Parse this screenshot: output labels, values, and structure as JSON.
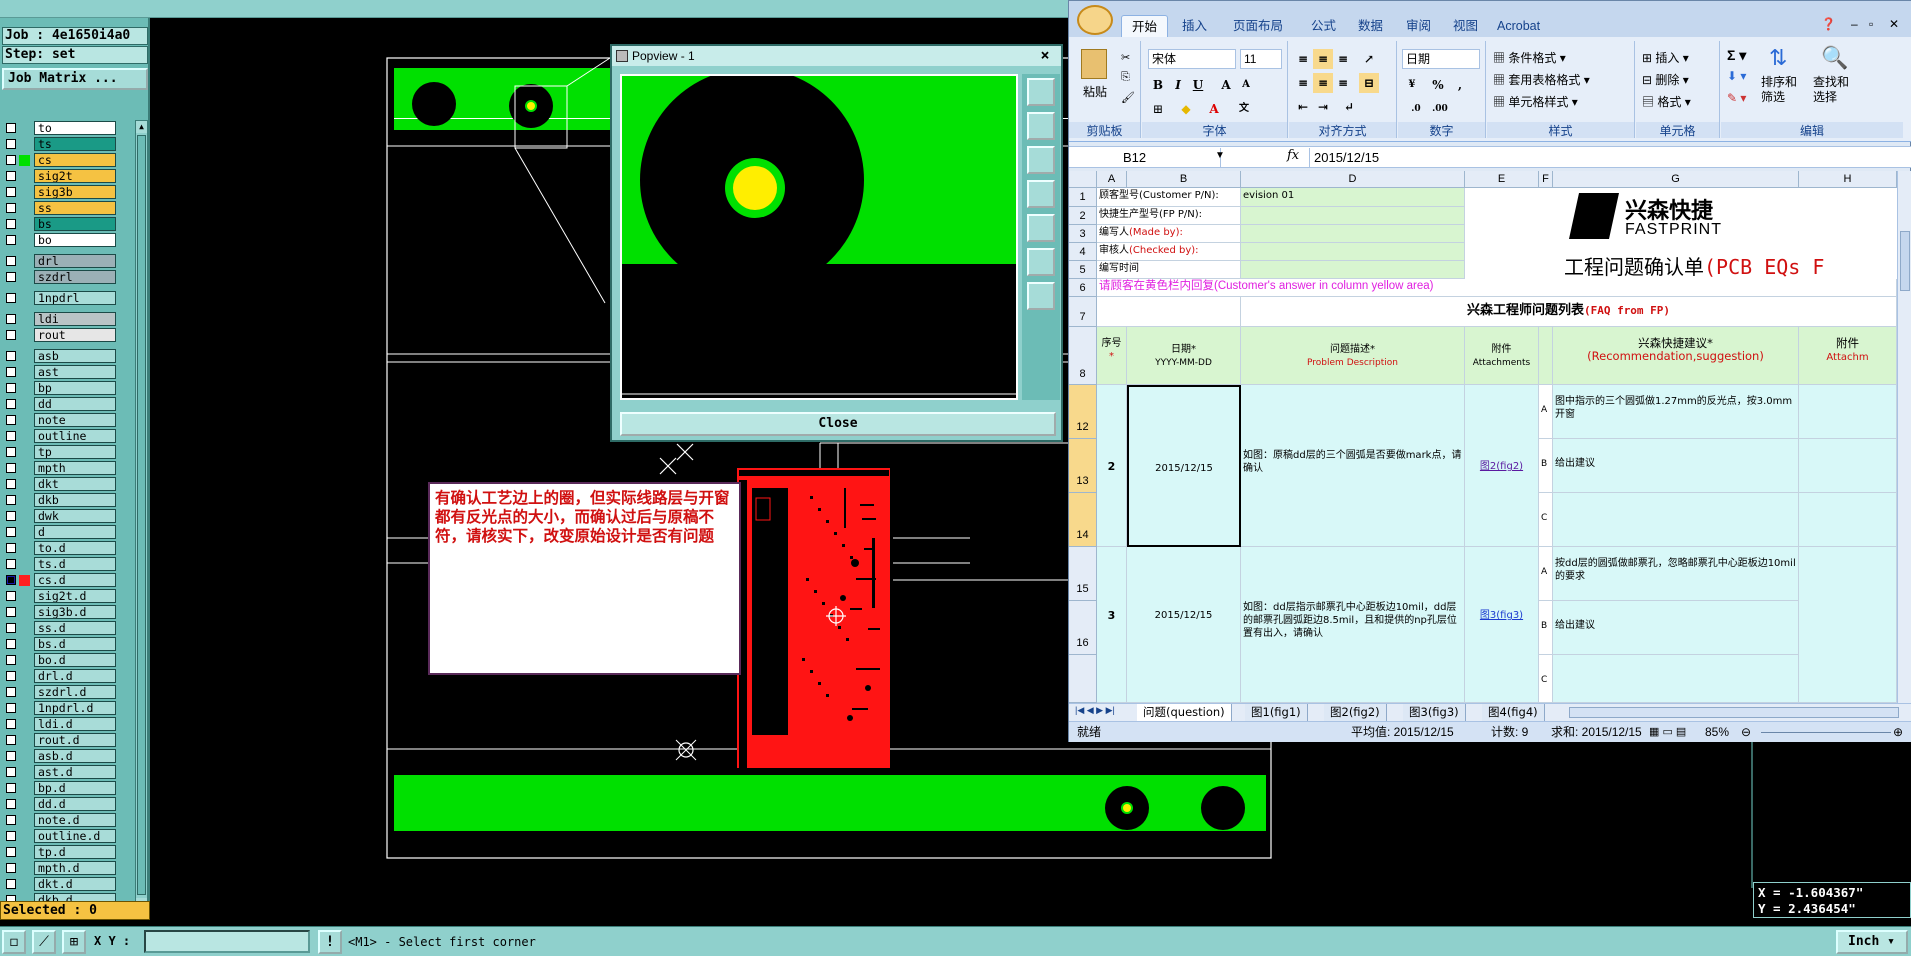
{
  "job_info": {
    "job": "Job : 4e1650i4a0",
    "step": "Step: set",
    "job_matrix_button": "Job Matrix ..."
  },
  "layers": [
    {
      "name": "to",
      "bg": "#ffffff",
      "sw": "",
      "checked": false
    },
    {
      "name": "ts",
      "bg": "#1a9a86",
      "sw": "",
      "checked": false
    },
    {
      "name": "cs",
      "bg": "#f5c242",
      "sw": "#00e000",
      "checked": false
    },
    {
      "name": "sig2t",
      "bg": "#f5c242",
      "sw": "",
      "checked": false
    },
    {
      "name": "sig3b",
      "bg": "#f5c242",
      "sw": "",
      "checked": false
    },
    {
      "name": "ss",
      "bg": "#f5c242",
      "sw": "",
      "checked": false
    },
    {
      "name": "bs",
      "bg": "#1a9a86",
      "sw": "",
      "checked": false
    },
    {
      "name": "bo",
      "bg": "#ffffff",
      "sw": "",
      "checked": false
    },
    {
      "name": "drl",
      "bg": "#9bb0b6",
      "sw": "",
      "checked": false,
      "sep": true
    },
    {
      "name": "szdrl",
      "bg": "#9bb0b6",
      "sw": "",
      "checked": false
    },
    {
      "name": "1npdrl",
      "bg": "#a8dcd8",
      "sw": "",
      "checked": false,
      "sep": true
    },
    {
      "name": "ldi",
      "bg": "#b9c4c6",
      "sw": "",
      "checked": false,
      "sep": true
    },
    {
      "name": "rout",
      "bg": "#e6e6e6",
      "sw": "",
      "checked": false
    },
    {
      "name": "asb",
      "bg": "#a8dcd8",
      "sw": "",
      "checked": false,
      "sep": true
    },
    {
      "name": "ast",
      "bg": "#a8dcd8",
      "sw": "",
      "checked": false
    },
    {
      "name": "bp",
      "bg": "#a8dcd8",
      "sw": "",
      "checked": false
    },
    {
      "name": "dd",
      "bg": "#a8dcd8",
      "sw": "",
      "checked": false
    },
    {
      "name": "note",
      "bg": "#a8dcd8",
      "sw": "",
      "checked": false
    },
    {
      "name": "outline",
      "bg": "#a8dcd8",
      "sw": "",
      "checked": false
    },
    {
      "name": "tp",
      "bg": "#a8dcd8",
      "sw": "",
      "checked": false
    },
    {
      "name": "mpth",
      "bg": "#a8dcd8",
      "sw": "",
      "checked": false
    },
    {
      "name": "dkt",
      "bg": "#a8dcd8",
      "sw": "",
      "checked": false
    },
    {
      "name": "dkb",
      "bg": "#a8dcd8",
      "sw": "",
      "checked": false
    },
    {
      "name": "dwk",
      "bg": "#a8dcd8",
      "sw": "",
      "checked": false
    },
    {
      "name": "d",
      "bg": "#a8dcd8",
      "sw": "",
      "checked": false
    },
    {
      "name": "to.d",
      "bg": "#a8dcd8",
      "sw": "",
      "checked": false
    },
    {
      "name": "ts.d",
      "bg": "#a8dcd8",
      "sw": "",
      "checked": false
    },
    {
      "name": "cs.d",
      "bg": "#a8dcd8",
      "sw": "#ff2020",
      "checked": true
    },
    {
      "name": "sig2t.d",
      "bg": "#a8dcd8",
      "sw": "",
      "checked": false
    },
    {
      "name": "sig3b.d",
      "bg": "#a8dcd8",
      "sw": "",
      "checked": false
    },
    {
      "name": "ss.d",
      "bg": "#a8dcd8",
      "sw": "",
      "checked": false
    },
    {
      "name": "bs.d",
      "bg": "#a8dcd8",
      "sw": "",
      "checked": false
    },
    {
      "name": "bo.d",
      "bg": "#a8dcd8",
      "sw": "",
      "checked": false
    },
    {
      "name": "drl.d",
      "bg": "#a8dcd8",
      "sw": "",
      "checked": false
    },
    {
      "name": "szdrl.d",
      "bg": "#a8dcd8",
      "sw": "",
      "checked": false
    },
    {
      "name": "1npdrl.d",
      "bg": "#a8dcd8",
      "sw": "",
      "checked": false
    },
    {
      "name": "ldi.d",
      "bg": "#a8dcd8",
      "sw": "",
      "checked": false
    },
    {
      "name": "rout.d",
      "bg": "#a8dcd8",
      "sw": "",
      "checked": false
    },
    {
      "name": "asb.d",
      "bg": "#a8dcd8",
      "sw": "",
      "checked": false
    },
    {
      "name": "ast.d",
      "bg": "#a8dcd8",
      "sw": "",
      "checked": false
    },
    {
      "name": "bp.d",
      "bg": "#a8dcd8",
      "sw": "",
      "checked": false
    },
    {
      "name": "dd.d",
      "bg": "#a8dcd8",
      "sw": "",
      "checked": false
    },
    {
      "name": "note.d",
      "bg": "#a8dcd8",
      "sw": "",
      "checked": false
    },
    {
      "name": "outline.d",
      "bg": "#a8dcd8",
      "sw": "",
      "checked": false
    },
    {
      "name": "tp.d",
      "bg": "#a8dcd8",
      "sw": "",
      "checked": false
    },
    {
      "name": "mpth.d",
      "bg": "#a8dcd8",
      "sw": "",
      "checked": false
    },
    {
      "name": "dkt.d",
      "bg": "#a8dcd8",
      "sw": "",
      "checked": false
    },
    {
      "name": "dkb.d",
      "bg": "#a8dcd8",
      "sw": "",
      "checked": false
    }
  ],
  "selected": "Selected : 0",
  "status": {
    "xy_label": "X Y :",
    "xy_value": "",
    "message": "<M1> - Select first corner",
    "unit": "Inch",
    "x_readout": "X = -1.604367\"",
    "y_readout": "Y = 2.436454\""
  },
  "popview": {
    "title": "Popview - 1",
    "close_x": "×",
    "close_button": "Close"
  },
  "note_text": "有确认工艺边上的圈，但实际线路层与开窗都有反光点的大小，而确认过后与原稿不符，请核实下，改变原始设计是否有问题",
  "excel": {
    "tabs": [
      "开始",
      "插入",
      "页面布局",
      "公式",
      "数据",
      "审阅",
      "视图",
      "Acrobat"
    ],
    "ribbon": {
      "paste": "粘贴",
      "font_name": "宋体",
      "font_size": "11",
      "number_format": "日期",
      "cond_format": "条件格式",
      "table_format": "套用表格格式",
      "cell_style": "单元格样式",
      "insert": "插入",
      "delete": "删除",
      "format": "格式",
      "sort_filter": "排序和\n筛选",
      "find_select": "查找和\n选择",
      "groups": [
        "剪贴板",
        "字体",
        "对齐方式",
        "数字",
        "样式",
        "单元格",
        "编辑"
      ]
    },
    "name_box": "B12",
    "fx": "fx",
    "formula": "2015/12/15",
    "col_headers": [
      "A",
      "B",
      "D",
      "E",
      "F",
      "G",
      "H"
    ],
    "row_labels": [
      "1",
      "2",
      "3",
      "4",
      "5",
      "6",
      "7",
      "8",
      "12",
      "13",
      "14",
      "15",
      "16"
    ],
    "rows": {
      "r1": "顾客型号(Customer P/N):",
      "r1_val": "evision 01",
      "r2": "快捷生产型号(FP P/N):",
      "r3a": "编写人",
      "r3b": "(Made by):",
      "r4a": "审核人",
      "r4b": "(Checked by):",
      "r5": "编写时间",
      "r6": "请顾客在黄色栏内回复(Customer's answer in column yellow area)",
      "r7a": "兴森工程师问题列表",
      "r7b": "(FAQ from FP)",
      "company_cn": "兴森快捷",
      "company_en": "FASTPRINT",
      "doc_title_a": "工程问题确认单",
      "doc_title_b": "(PCB EQs F"
    },
    "headers": {
      "seq": "序号",
      "seq_star": "*",
      "date": "日期*",
      "date_fmt": "YYYY-MM-DD",
      "problem_cn": "问题描述*",
      "problem_en": "Problem Description",
      "attach_cn": "附件",
      "attach_en": "Attachments",
      "suggest_cn": "兴森快捷建议*",
      "suggest_en": "(Recommendation,suggestion)",
      "attach2_cn": "附件",
      "attach2_en": "Attachm"
    },
    "items": [
      {
        "no": "2",
        "date": "2015/12/15",
        "problem": "如图：原稿dd层的三个圆弧是否要做mark点，请确认",
        "attach": "图2(fig2)",
        "opts": [
          "A",
          "B",
          "C"
        ],
        "suggest": [
          "图中指示的三个圆弧做1.27mm的反光点，按3.0mm开窗",
          "给出建议",
          ""
        ]
      },
      {
        "no": "3",
        "date": "2015/12/15",
        "problem": "如图：dd层指示邮票孔中心距板边10mil，dd层的邮票孔圆弧距边8.5mil，且和提供的np孔层位置有出入，请确认",
        "attach": "图3(fig3)",
        "opts": [
          "A",
          "B",
          "C"
        ],
        "suggest": [
          "按dd层的圆弧做邮票孔，忽略邮票孔中心距板边10mil的要求",
          "给出建议",
          ""
        ]
      }
    ],
    "sheets": [
      "问题(question)",
      "图1(fig1)",
      "图2(fig2)",
      "图3(fig3)",
      "图4(fig4)"
    ],
    "status_ready": "就绪",
    "status_avg": "平均值: 2015/12/15",
    "status_count": "计数: 9",
    "status_sum": "求和: 2015/12/15",
    "zoom": "85%"
  }
}
